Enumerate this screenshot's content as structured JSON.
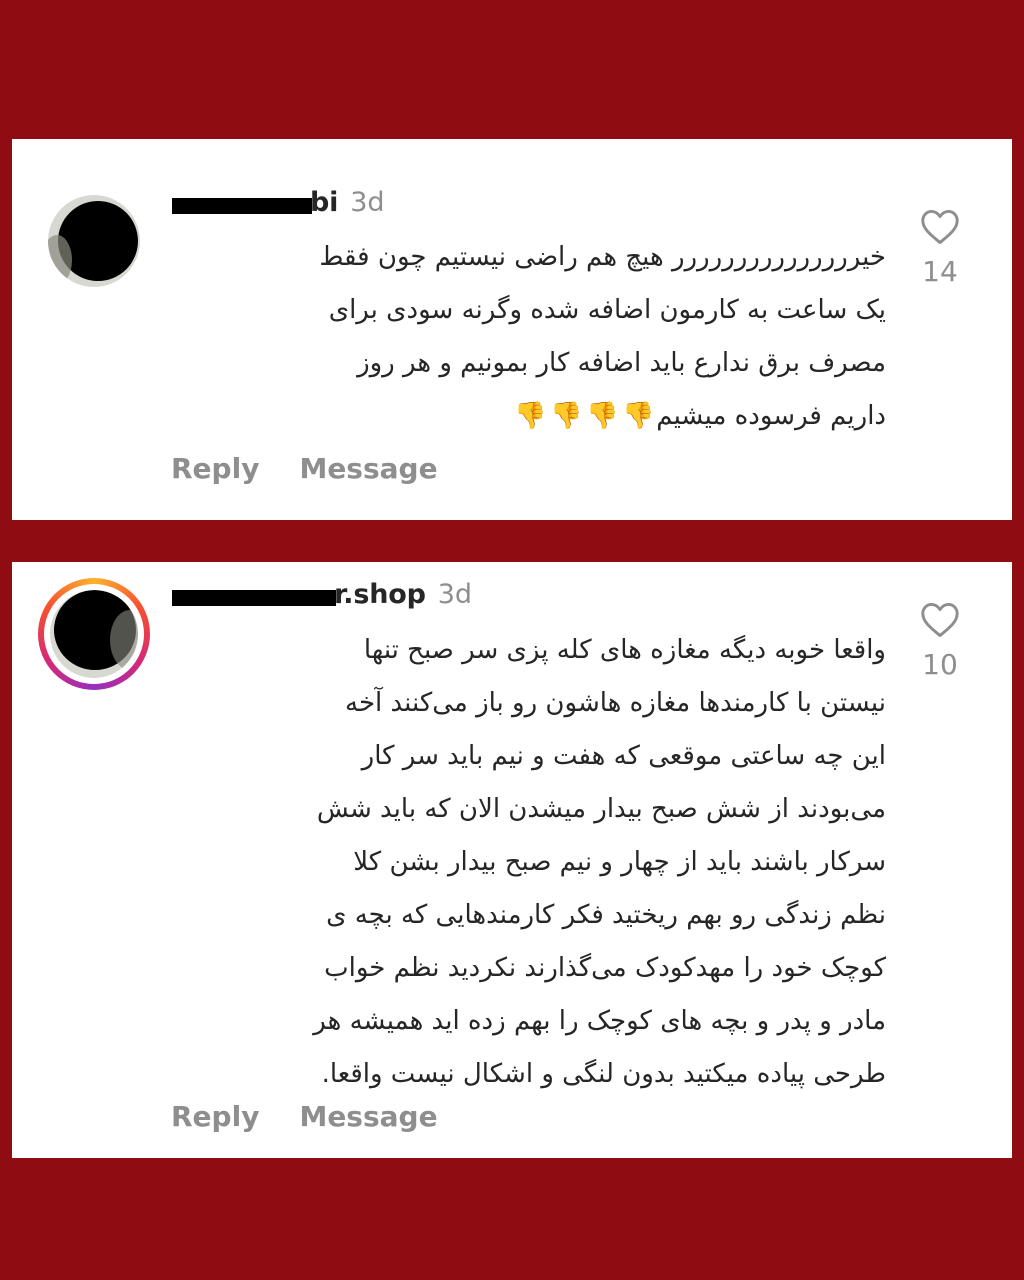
{
  "comments": [
    {
      "username_visible": "bi",
      "time": "3d",
      "text_lines": [
        "خیررررررررررررررر هیچ هم راضی نیستیم چون فقط",
        "یک ساعت به کارمون اضافه شده وگرنه سودی برای",
        "مصرف برق ندارع باید اضافه کار بمونیم و هر روز",
        "داریم فرسوده میشیم"
      ],
      "reaction_emoji": "👎",
      "reaction_count": 4,
      "like_count": "14",
      "reply_label": "Reply",
      "message_label": "Message",
      "avatar_story_ring": false
    },
    {
      "username_visible": "r.shop",
      "time": "3d",
      "text_lines": [
        "واقعا خوبه دیگه مغازه های کله پزی سر صبح تنها",
        "نیستن با کارمندها مغازه هاشون رو باز می‌کنند آخه",
        "این چه ساعتی موقعی که هفت و نیم باید سر کار",
        "می‌بودند از شش صبح بیدار میشدن الان که باید شش",
        "سرکار باشند باید از چهار و نیم صبح بیدار بشن کلا",
        "نظم زندگی رو بهم ریختید فکر کارمندهایی که بچه ی",
        "کوچک خود را مهدکودک می‌گذارند نکردید نظم خواب",
        "مادر و پدر و بچه های کوچک را بهم زده اید همیشه هر",
        "طرحی پیاده میکتید بدون لنگی و اشکال نیست واقعا."
      ],
      "like_count": "10",
      "reply_label": "Reply",
      "message_label": "Message",
      "avatar_story_ring": true
    }
  ],
  "icons": {
    "like": "heart-outline-icon",
    "reaction": "thumbs-down-icon"
  },
  "colors": {
    "background": "#8f0c12",
    "card": "#ffffff",
    "text": "#262626",
    "muted": "#8e8e8e"
  }
}
